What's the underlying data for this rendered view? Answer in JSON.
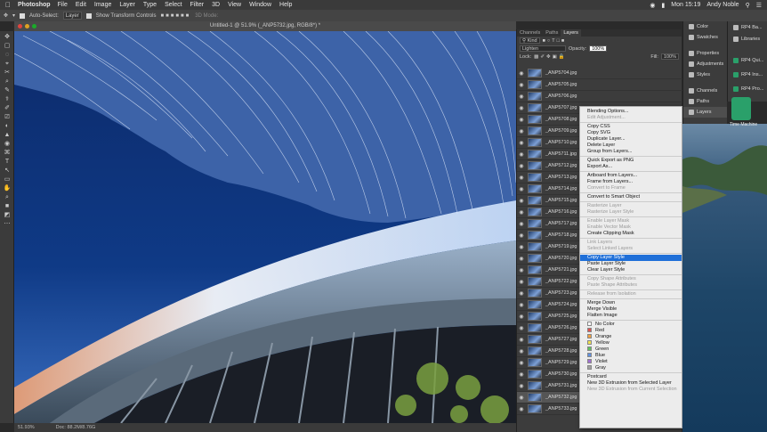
{
  "menubar": {
    "app": "Photoshop",
    "items": [
      "File",
      "Edit",
      "Image",
      "Layer",
      "Type",
      "Select",
      "Filter",
      "3D",
      "View",
      "Window",
      "Help"
    ],
    "clock": "Mon 15:19",
    "user": "Andy Noble"
  },
  "options": {
    "auto_select": "Auto-Select:",
    "auto_select_value": "Layer",
    "transform": "Show Transform Controls",
    "mode": "3D Mode:"
  },
  "document": {
    "title": "Untitled-1 @ 51.9% (_ANP5732.jpg, RGB/8*) *",
    "zoom": "51.93%",
    "doc_size": "Doc: 88.2M/8.76G"
  },
  "layers_panel": {
    "tabs": [
      "Channels",
      "Paths",
      "Layers"
    ],
    "kind": "Kind",
    "blend_mode": "Lighten",
    "opacity_label": "Opacity:",
    "opacity": "100%",
    "lock_label": "Lock:",
    "fill_label": "Fill:",
    "fill": "100%",
    "layers": [
      "_ANP5704.jpg",
      "_ANP5705.jpg",
      "_ANP5706.jpg",
      "_ANP5707.jpg",
      "_ANP5708.jpg",
      "_ANP5709.jpg",
      "_ANP5710.jpg",
      "_ANP5711.jpg",
      "_ANP5712.jpg",
      "_ANP5713.jpg",
      "_ANP5714.jpg",
      "_ANP5715.jpg",
      "_ANP5716.jpg",
      "_ANP5717.jpg",
      "_ANP5718.jpg",
      "_ANP5719.jpg",
      "_ANP5720.jpg",
      "_ANP5721.jpg",
      "_ANP5722.jpg",
      "_ANP5723.jpg",
      "_ANP5724.jpg",
      "_ANP5725.jpg",
      "_ANP5726.jpg",
      "_ANP5727.jpg",
      "_ANP5728.jpg",
      "_ANP5729.jpg",
      "_ANP5730.jpg",
      "_ANP5731.jpg",
      "_ANP5732.jpg",
      "_ANP5733.jpg"
    ]
  },
  "context_menu": {
    "items": [
      {
        "label": "Blending Options...",
        "state": "normal"
      },
      {
        "label": "Edit Adjustment...",
        "state": "disabled"
      },
      {
        "sep": true
      },
      {
        "label": "Copy CSS",
        "state": "normal"
      },
      {
        "label": "Copy SVG",
        "state": "normal"
      },
      {
        "label": "Duplicate Layer...",
        "state": "normal"
      },
      {
        "label": "Delete Layer",
        "state": "normal"
      },
      {
        "label": "Group from Layers...",
        "state": "normal"
      },
      {
        "sep": true
      },
      {
        "label": "Quick Export as PNG",
        "state": "normal"
      },
      {
        "label": "Export As...",
        "state": "normal"
      },
      {
        "sep": true
      },
      {
        "label": "Artboard from Layers...",
        "state": "normal"
      },
      {
        "label": "Frame from Layers...",
        "state": "normal"
      },
      {
        "label": "Convert to Frame",
        "state": "disabled"
      },
      {
        "sep": true
      },
      {
        "label": "Convert to Smart Object",
        "state": "normal"
      },
      {
        "sep": true
      },
      {
        "label": "Rasterize Layer",
        "state": "disabled"
      },
      {
        "label": "Rasterize Layer Style",
        "state": "disabled"
      },
      {
        "sep": true
      },
      {
        "label": "Enable Layer Mask",
        "state": "disabled"
      },
      {
        "label": "Enable Vector Mask",
        "state": "disabled"
      },
      {
        "label": "Create Clipping Mask",
        "state": "normal"
      },
      {
        "sep": true
      },
      {
        "label": "Link Layers",
        "state": "disabled"
      },
      {
        "label": "Select Linked Layers",
        "state": "disabled"
      },
      {
        "sep": true
      },
      {
        "label": "Copy Layer Style",
        "state": "highlight"
      },
      {
        "label": "Paste Layer Style",
        "state": "normal"
      },
      {
        "label": "Clear Layer Style",
        "state": "normal"
      },
      {
        "sep": true
      },
      {
        "label": "Copy Shape Attributes",
        "state": "disabled"
      },
      {
        "label": "Paste Shape Attributes",
        "state": "disabled"
      },
      {
        "sep": true
      },
      {
        "label": "Release from Isolation",
        "state": "disabled"
      },
      {
        "sep": true
      },
      {
        "label": "Merge Down",
        "state": "normal"
      },
      {
        "label": "Merge Visible",
        "state": "normal"
      },
      {
        "label": "Flatten Image",
        "state": "normal"
      },
      {
        "sep": true
      },
      {
        "label": "No Color",
        "state": "normal",
        "swatch": "#ffffff"
      },
      {
        "label": "Red",
        "state": "normal",
        "swatch": "#e05050"
      },
      {
        "label": "Orange",
        "state": "normal",
        "swatch": "#f0a040"
      },
      {
        "label": "Yellow",
        "state": "normal",
        "swatch": "#f0e050"
      },
      {
        "label": "Green",
        "state": "normal",
        "swatch": "#60c060"
      },
      {
        "label": "Blue",
        "state": "normal",
        "swatch": "#6090e0"
      },
      {
        "label": "Violet",
        "state": "normal",
        "swatch": "#a070d0"
      },
      {
        "label": "Gray",
        "state": "normal",
        "swatch": "#a0a0a0"
      },
      {
        "sep": true
      },
      {
        "label": "Postcard",
        "state": "normal"
      },
      {
        "label": "New 3D Extrusion from Selected Layer",
        "state": "normal"
      },
      {
        "label": "New 3D Extrusion from Current Selection",
        "state": "disabled"
      }
    ]
  },
  "dock": {
    "col1": [
      "Color",
      "Swatches",
      "Properties",
      "Adjustments",
      "Styles",
      "Channels",
      "Paths",
      "Layers"
    ],
    "col2": [
      "RP4 Ba...",
      "Libraries",
      "RP4 Qui...",
      "RP4 Ins...",
      "RP4 Pro..."
    ]
  },
  "desktop": {
    "time_machine_label": "Time Machine"
  }
}
